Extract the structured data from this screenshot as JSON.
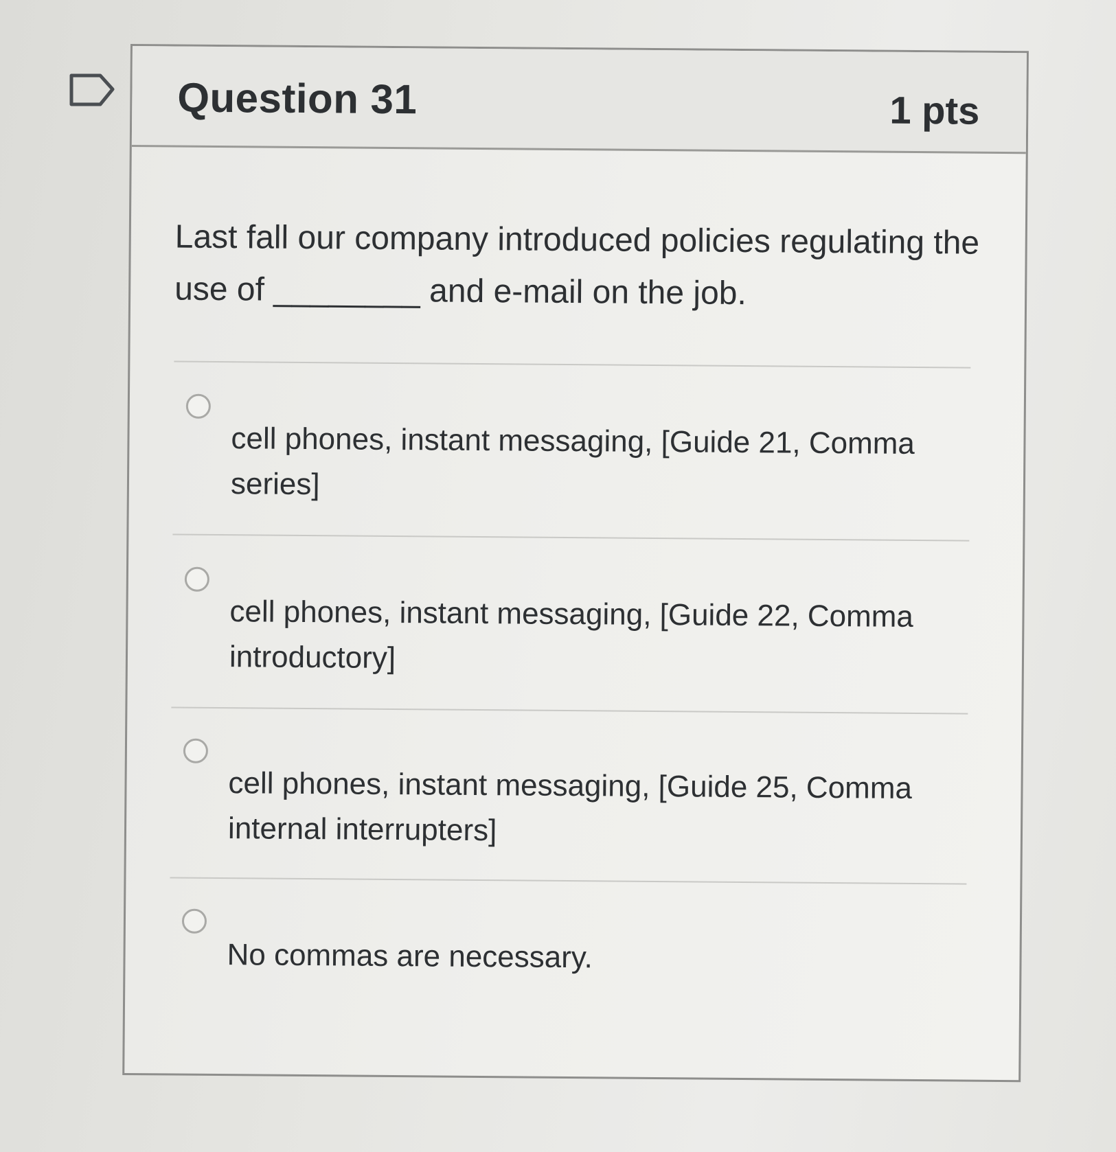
{
  "question": {
    "title": "Question 31",
    "points": "1 pts",
    "text_before_blank": "Last fall our company introduced policies regulating the use of ",
    "blank": "________",
    "text_after_blank": " and e-mail on the job."
  },
  "answers": [
    {
      "label": "cell phones, instant messaging, [Guide 21, Comma series]",
      "selected": false
    },
    {
      "label": "cell phones, instant messaging, [Guide 22, Comma introductory]",
      "selected": false
    },
    {
      "label": "cell phones, instant messaging, [Guide 25, Comma internal interrupters]",
      "selected": false
    },
    {
      "label": "No commas are necessary.",
      "selected": false
    }
  ],
  "icons": {
    "flag": "flag-question-icon",
    "radio": "radio-unchecked-icon"
  },
  "colors": {
    "text": "#2d3033",
    "border": "#8e8e8c",
    "radio_border": "#a9a9a6"
  }
}
